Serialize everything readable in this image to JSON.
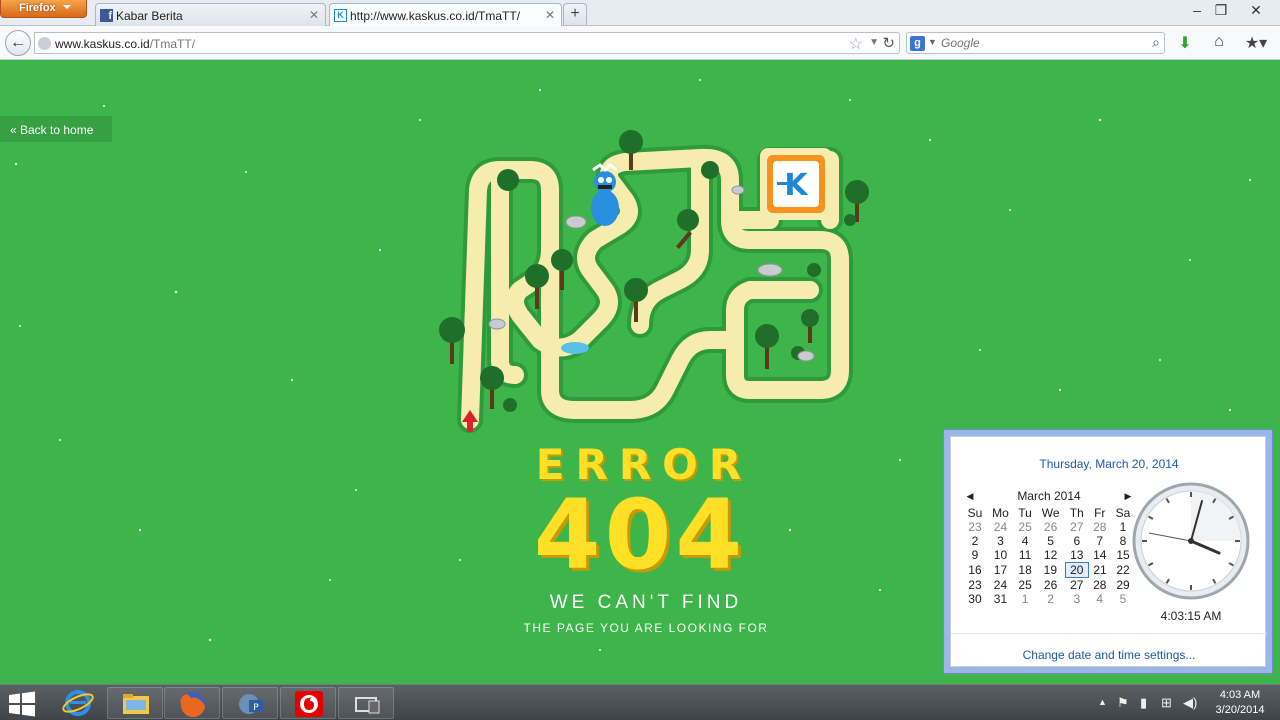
{
  "browser": {
    "menu_button": "Firefox",
    "tabs": [
      {
        "label": "Kabar Berita",
        "active": false
      },
      {
        "label": "http://www.kaskus.co.id/TmaTT/",
        "active": true
      }
    ],
    "new_tab": "+",
    "url_domain": "www.kaskus.co.id",
    "url_path": "/TmaTT/",
    "search_placeholder": "Google",
    "search_engine_letter": "g"
  },
  "page": {
    "back_link": "« Back to home",
    "error_word": "ERROR",
    "error_code": "404",
    "line1": "WE CAN'T FIND",
    "line2": "THE PAGE YOU ARE LOOKING FOR",
    "logo_letter": "K"
  },
  "flyout": {
    "full_date": "Thursday, March 20, 2014",
    "month_title": "March 2014",
    "weekdays": [
      "Su",
      "Mo",
      "Tu",
      "We",
      "Th",
      "Fr",
      "Sa"
    ],
    "weeks": [
      [
        "23",
        "24",
        "25",
        "26",
        "27",
        "28",
        "1"
      ],
      [
        "2",
        "3",
        "4",
        "5",
        "6",
        "7",
        "8"
      ],
      [
        "9",
        "10",
        "11",
        "12",
        "13",
        "14",
        "15"
      ],
      [
        "16",
        "17",
        "18",
        "19",
        "20",
        "21",
        "22"
      ],
      [
        "23",
        "24",
        "25",
        "26",
        "27",
        "28",
        "29"
      ],
      [
        "30",
        "31",
        "1",
        "2",
        "3",
        "4",
        "5"
      ]
    ],
    "today": "20",
    "time": "4:03:15 AM",
    "change_link": "Change date and time settings..."
  },
  "taskbar": {
    "clock_time": "4:03 AM",
    "clock_date": "3/20/2014"
  },
  "colors": {
    "page_green": "#3db54a",
    "path": "#f6ecae",
    "error_yellow": "#ffe026",
    "link_blue": "#1e5aa8"
  }
}
